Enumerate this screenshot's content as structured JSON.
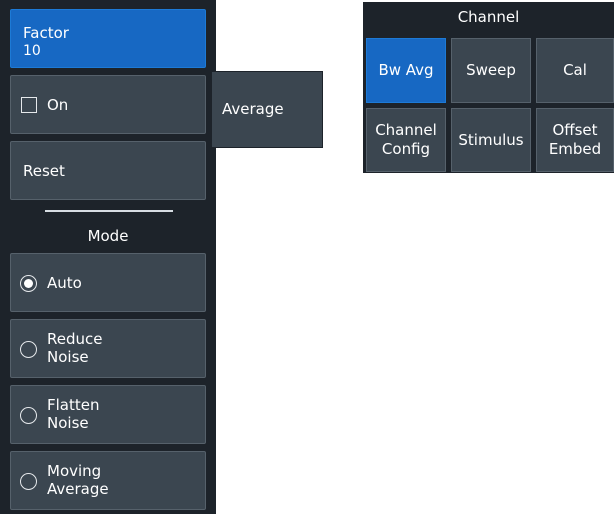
{
  "left_panel": {
    "factor": {
      "label": "Factor",
      "value": "10"
    },
    "on_toggle": {
      "label": "On",
      "checked": false
    },
    "reset_label": "Reset",
    "mode_heading": "Mode",
    "modes": [
      {
        "line1": "Auto",
        "line2": "",
        "selected": true
      },
      {
        "line1": "Reduce",
        "line2": "Noise",
        "selected": false
      },
      {
        "line1": "Flatten",
        "line2": "Noise",
        "selected": false
      },
      {
        "line1": "Moving",
        "line2": "Average",
        "selected": false
      }
    ]
  },
  "subtab": {
    "label": "Average"
  },
  "channel_menu": {
    "title": "Channel",
    "buttons": [
      {
        "line1": "Bw Avg",
        "line2": "",
        "active": true
      },
      {
        "line1": "Sweep",
        "line2": "",
        "active": false
      },
      {
        "line1": "Cal",
        "line2": "",
        "active": false
      },
      {
        "line1": "Channel",
        "line2": "Config",
        "active": false
      },
      {
        "line1": "Stimulus",
        "line2": "",
        "active": false
      },
      {
        "line1": "Offset",
        "line2": "Embed",
        "active": false
      }
    ]
  },
  "colors": {
    "panel_bg": "#1d232a",
    "button_bg": "#3b4650",
    "active_accent": "#1768c3",
    "text": "#ffffff"
  }
}
